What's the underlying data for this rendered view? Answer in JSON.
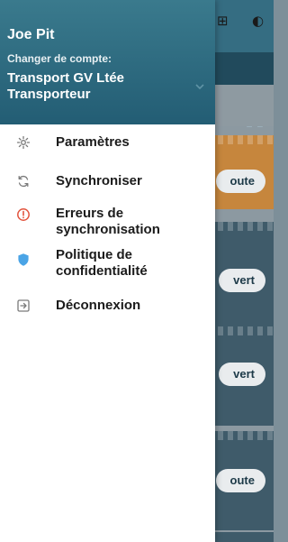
{
  "background": {
    "buttons": [
      {
        "label": "oute"
      },
      {
        "label": "vert"
      },
      {
        "label": "vert"
      },
      {
        "label": "oute"
      }
    ]
  },
  "drawer": {
    "user_name": "Joe Pit",
    "switch_label": "Changer de compte:",
    "account_name": "Transport GV Ltée Transporteur",
    "menu": [
      {
        "label": "Paramètres",
        "icon": "gear-icon"
      },
      {
        "label": "Synchroniser",
        "icon": "sync-icon"
      },
      {
        "label": "Erreurs de synchronisation",
        "icon": "error-icon"
      },
      {
        "label": "Politique de confidentialité",
        "icon": "shield-icon"
      },
      {
        "label": "Déconnexion",
        "icon": "logout-icon"
      }
    ]
  },
  "colors": {
    "header": "#2f6d83",
    "error": "#e2533d",
    "shield": "#4aa4e6"
  }
}
